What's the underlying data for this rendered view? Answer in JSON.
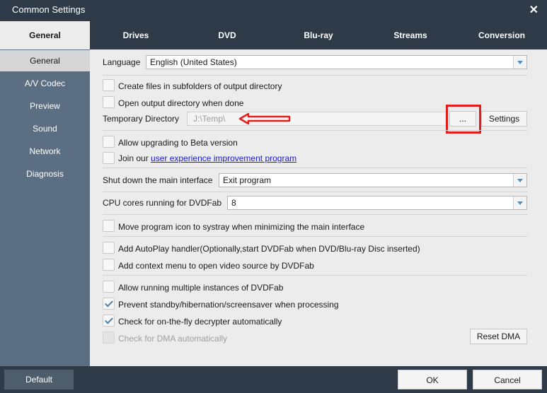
{
  "window": {
    "title": "Common Settings"
  },
  "top_tabs": [
    {
      "label": "General",
      "active": true
    },
    {
      "label": "Drives"
    },
    {
      "label": "DVD"
    },
    {
      "label": "Blu-ray"
    },
    {
      "label": "Streams"
    },
    {
      "label": "Conversion"
    }
  ],
  "sidebar": {
    "items": [
      {
        "label": "General",
        "active": true
      },
      {
        "label": "A/V Codec"
      },
      {
        "label": "Preview"
      },
      {
        "label": "Sound"
      },
      {
        "label": "Network"
      },
      {
        "label": "Diagnosis"
      }
    ]
  },
  "settings": {
    "language_label": "Language",
    "language_value": "English (United States)",
    "create_subfolders": {
      "label": "Create files in subfolders of output directory",
      "checked": false
    },
    "open_output": {
      "label": "Open output directory when done",
      "checked": false
    },
    "temp_dir_label": "Temporary Directory",
    "temp_dir_value": "J:\\Temp\\",
    "browse_label": "...",
    "settings_button": "Settings",
    "beta_upgrade": {
      "label": "Allow upgrading to Beta version",
      "checked": false
    },
    "join_prefix": "Join our ",
    "join_link": "user experience improvement program",
    "shutdown_label": "Shut down the main interface",
    "shutdown_value": "Exit program",
    "cpu_label": "CPU cores running for DVDFab",
    "cpu_value": "8",
    "systray": {
      "label": "Move program icon to systray when minimizing the main interface",
      "checked": false
    },
    "autoplay": {
      "label": "Add AutoPlay handler(Optionally,start DVDFab when DVD/Blu-ray Disc inserted)",
      "checked": false
    },
    "context_menu": {
      "label": "Add context menu to open video source by DVDFab",
      "checked": false
    },
    "multiple_instances": {
      "label": "Allow running multiple instances of DVDFab",
      "checked": false
    },
    "prevent_standby": {
      "label": "Prevent standby/hibernation/screensaver when processing",
      "checked": true
    },
    "on_the_fly": {
      "label": "Check for on-the-fly decrypter automatically",
      "checked": true
    },
    "dma_check": {
      "label": "Check for DMA automatically",
      "checked": false,
      "disabled": true
    },
    "reset_dma": "Reset DMA"
  },
  "footer": {
    "default_label": "Default",
    "ok_label": "OK",
    "cancel_label": "Cancel"
  },
  "colors": {
    "dark_bg": "#2e3a47",
    "sidebar_bg": "#5b6e82",
    "content_bg": "#ececec",
    "highlight_red": "#e01e1e",
    "arrow_blue": "#4a8fc9"
  }
}
